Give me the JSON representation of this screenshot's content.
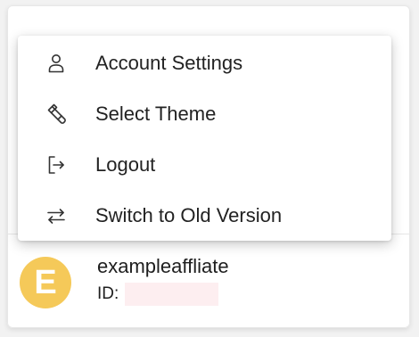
{
  "menu": {
    "items": [
      {
        "label": "Account Settings",
        "icon": "user-icon"
      },
      {
        "label": "Select Theme",
        "icon": "paintbrush-icon"
      },
      {
        "label": "Logout",
        "icon": "logout-icon"
      },
      {
        "label": "Switch to Old Version",
        "icon": "swap-arrows-icon"
      }
    ]
  },
  "user": {
    "avatar_initial": "E",
    "name": "exampleaffliate",
    "id_label": "ID:",
    "avatar_color": "#f5c959"
  }
}
